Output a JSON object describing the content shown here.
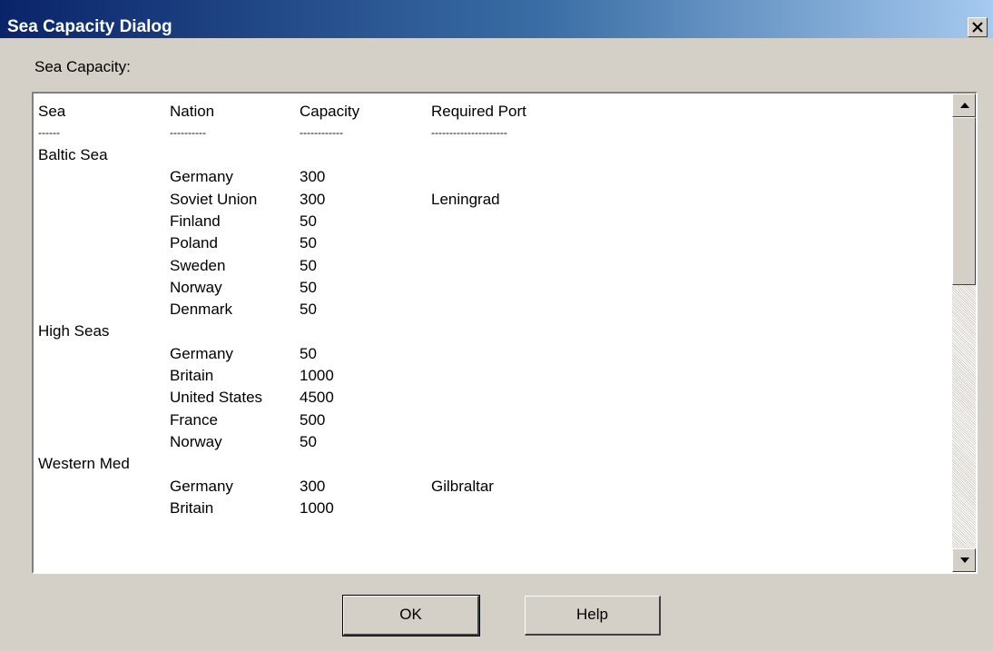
{
  "window": {
    "title": "Sea Capacity Dialog",
    "close_glyph": "×"
  },
  "group_label": "Sea Capacity:",
  "list": {
    "headers": [
      "Sea",
      "Nation",
      "Capacity",
      "Required Port"
    ],
    "separators": [
      "------",
      "----------",
      "------------",
      "---------------------"
    ],
    "rows": [
      {
        "sea": "Baltic Sea",
        "nation": "",
        "capacity": "",
        "port": ""
      },
      {
        "sea": "",
        "nation": "Germany",
        "capacity": "300",
        "port": ""
      },
      {
        "sea": "",
        "nation": "Soviet Union",
        "capacity": "300",
        "port": "Leningrad"
      },
      {
        "sea": "",
        "nation": "Finland",
        "capacity": "50",
        "port": ""
      },
      {
        "sea": "",
        "nation": "Poland",
        "capacity": "50",
        "port": ""
      },
      {
        "sea": "",
        "nation": "Sweden",
        "capacity": "50",
        "port": ""
      },
      {
        "sea": "",
        "nation": "Norway",
        "capacity": "50",
        "port": ""
      },
      {
        "sea": "",
        "nation": "Denmark",
        "capacity": "50",
        "port": ""
      },
      {
        "sea": "High Seas",
        "nation": "",
        "capacity": "",
        "port": ""
      },
      {
        "sea": "",
        "nation": "Germany",
        "capacity": "50",
        "port": ""
      },
      {
        "sea": "",
        "nation": "Britain",
        "capacity": "1000",
        "port": ""
      },
      {
        "sea": "",
        "nation": "United States",
        "capacity": "4500",
        "port": ""
      },
      {
        "sea": "",
        "nation": "France",
        "capacity": "500",
        "port": ""
      },
      {
        "sea": "",
        "nation": "Norway",
        "capacity": "50",
        "port": ""
      },
      {
        "sea": "Western Med",
        "nation": "",
        "capacity": "",
        "port": ""
      },
      {
        "sea": "",
        "nation": "Germany",
        "capacity": "300",
        "port": "Gilbraltar"
      },
      {
        "sea": "",
        "nation": "Britain",
        "capacity": "1000",
        "port": ""
      }
    ]
  },
  "buttons": {
    "ok": "OK",
    "help": "Help"
  },
  "icons": {
    "close": "close-icon",
    "scroll_up": "arrow-up-icon",
    "scroll_down": "arrow-down-icon"
  }
}
